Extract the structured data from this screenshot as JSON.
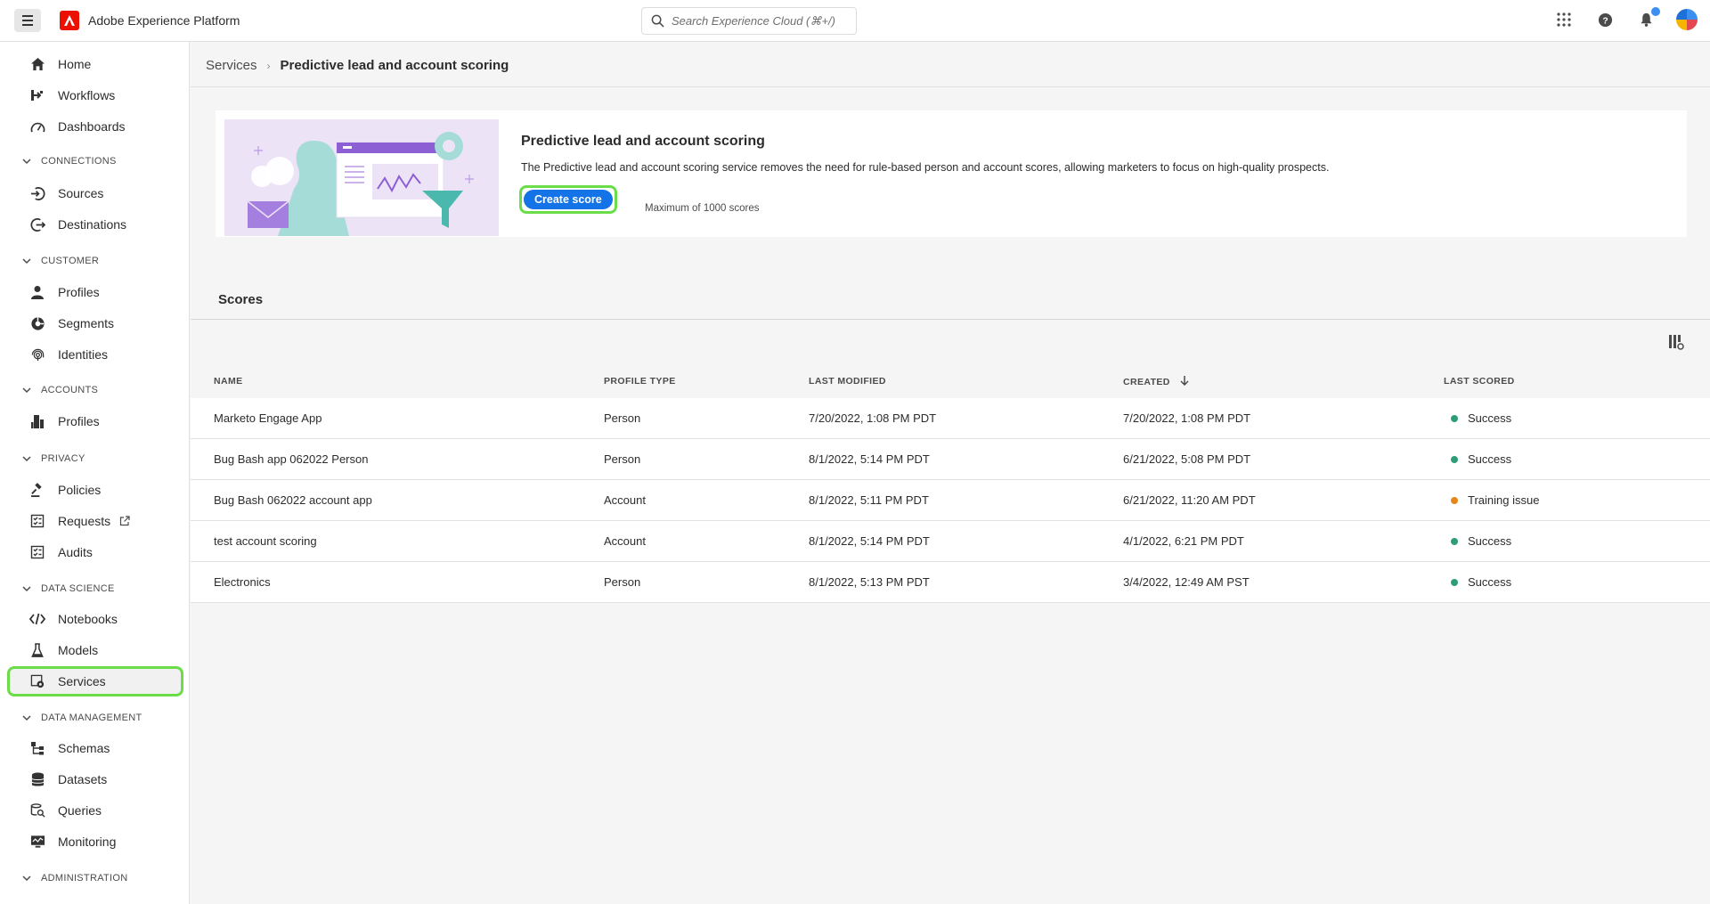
{
  "app": {
    "title": "Adobe Experience Platform"
  },
  "search": {
    "placeholder": "Search Experience Cloud (⌘+/)"
  },
  "sidebar": {
    "items": [
      {
        "label": "Home",
        "icon": "home-icon"
      },
      {
        "label": "Workflows",
        "icon": "workflow-icon"
      },
      {
        "label": "Dashboards",
        "icon": "dashboard-icon"
      },
      {
        "section": "CONNECTIONS"
      },
      {
        "label": "Sources",
        "icon": "sources-icon"
      },
      {
        "label": "Destinations",
        "icon": "destinations-icon"
      },
      {
        "section": "CUSTOMER"
      },
      {
        "label": "Profiles",
        "icon": "profile-icon"
      },
      {
        "label": "Segments",
        "icon": "segments-icon"
      },
      {
        "label": "Identities",
        "icon": "fingerprint-icon"
      },
      {
        "section": "ACCOUNTS"
      },
      {
        "label": "Profiles",
        "icon": "building-icon"
      },
      {
        "section": "PRIVACY"
      },
      {
        "label": "Policies",
        "icon": "gavel-icon"
      },
      {
        "label": "Requests",
        "icon": "requests-icon",
        "external": true
      },
      {
        "label": "Audits",
        "icon": "audits-icon"
      },
      {
        "section": "DATA SCIENCE"
      },
      {
        "label": "Notebooks",
        "icon": "code-icon"
      },
      {
        "label": "Models",
        "icon": "beaker-icon"
      },
      {
        "label": "Services",
        "icon": "services-icon",
        "selected": true
      },
      {
        "section": "DATA MANAGEMENT"
      },
      {
        "label": "Schemas",
        "icon": "schema-icon"
      },
      {
        "label": "Datasets",
        "icon": "database-icon"
      },
      {
        "label": "Queries",
        "icon": "query-icon"
      },
      {
        "label": "Monitoring",
        "icon": "monitoring-icon"
      },
      {
        "section": "ADMINISTRATION"
      }
    ]
  },
  "breadcrumb": {
    "parent": "Services",
    "current": "Predictive lead and account scoring"
  },
  "card": {
    "title": "Predictive lead and account scoring",
    "description": "The Predictive lead and account scoring service removes the need for rule-based person and account scores, allowing marketers to focus on high-quality prospects.",
    "button": "Create score",
    "note": "Maximum of 1000 scores"
  },
  "scores": {
    "title": "Scores",
    "columns": [
      "NAME",
      "PROFILE TYPE",
      "LAST MODIFIED",
      "CREATED",
      "LAST SCORED"
    ],
    "rows": [
      {
        "name": "Marketo Engage App",
        "type": "Person",
        "modified": "7/20/2022, 1:08 PM PDT",
        "created": "7/20/2022, 1:08 PM PDT",
        "status": "Success",
        "status_color": "#2d9d78"
      },
      {
        "name": "Bug Bash app 062022 Person",
        "type": "Person",
        "modified": "8/1/2022, 5:14 PM PDT",
        "created": "6/21/2022, 5:08 PM PDT",
        "status": "Success",
        "status_color": "#2d9d78"
      },
      {
        "name": "Bug Bash 062022 account app",
        "type": "Account",
        "modified": "8/1/2022, 5:11 PM PDT",
        "created": "6/21/2022, 11:20 AM PDT",
        "status": "Training issue",
        "status_color": "#e68619"
      },
      {
        "name": "test account scoring",
        "type": "Account",
        "modified": "8/1/2022, 5:14 PM PDT",
        "created": "4/1/2022, 6:21 PM PDT",
        "status": "Success",
        "status_color": "#2d9d78"
      },
      {
        "name": "Electronics",
        "type": "Person",
        "modified": "8/1/2022, 5:13 PM PDT",
        "created": "3/4/2022, 12:49 AM PST",
        "status": "Success",
        "status_color": "#2d9d78"
      }
    ]
  },
  "colors": {
    "accent": "#1473e6",
    "highlight": "#6bdd48",
    "success": "#2d9d78",
    "warning": "#e68619"
  }
}
